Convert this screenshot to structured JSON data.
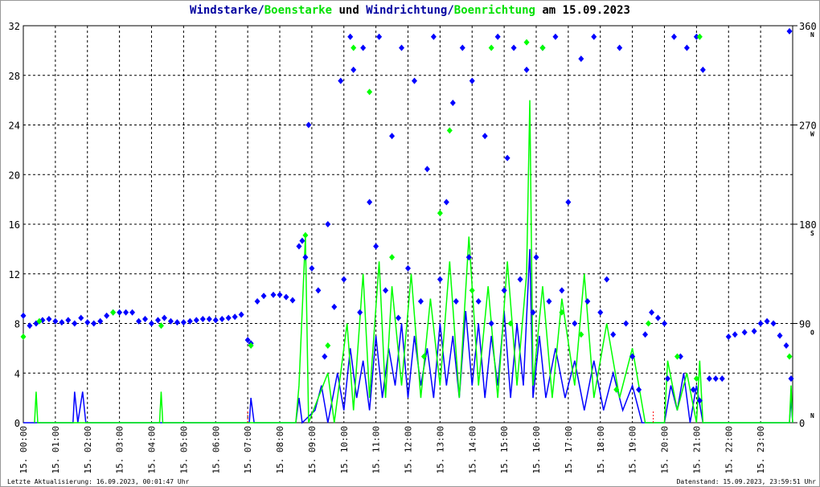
{
  "title": {
    "part1": "Windstarke",
    "sep1": "/",
    "part2": "Boenstarke",
    "mid": " und ",
    "part3": "Windrichtung",
    "sep2": "/",
    "part4": "Boenrichtung",
    "end": " am 15.09.2023"
  },
  "footer": {
    "left": "Letzte Aktualisierung: 16.09.2023, 00:01:47 Uhr",
    "right": "Datenstand: 15.09.2023, 23:59:51 Uhr"
  },
  "chart_data": {
    "type": "line",
    "title": "Windstarke/Boenstarke und Windrichtung/Boenrichtung am 15.09.2023",
    "xlabel": "",
    "ylabel": "",
    "xlim": [
      0,
      24
    ],
    "ylim": [
      0,
      32
    ],
    "y2lim": [
      0,
      360
    ],
    "y_ticks": [
      "0",
      "4",
      "8",
      "12",
      "16",
      "20",
      "24",
      "28",
      "32"
    ],
    "y2_ticks": [
      "0",
      "90",
      "180",
      "270",
      "360"
    ],
    "y2_compass": [
      "N",
      "O",
      "S",
      "W",
      "N"
    ],
    "x_ticks": [
      "15. 00:00",
      "15. 01:00",
      "15. 02:00",
      "15. 03:00",
      "15. 04:00",
      "15. 05:00",
      "15. 06:00",
      "15. 07:00",
      "15. 08:00",
      "15. 09:00",
      "15. 10:00",
      "15. 11:00",
      "15. 12:00",
      "15. 13:00",
      "15. 14:00",
      "15. 15:00",
      "15. 16:00",
      "15. 17:00",
      "15. 18:00",
      "15. 19:00",
      "15. 20:00",
      "15. 21:00",
      "15. 22:00",
      "15. 23:00"
    ],
    "grid": true,
    "colors": {
      "wind": "#0000ff",
      "gust": "#00ff00",
      "calm": "#ff0000"
    },
    "series": [
      {
        "name": "Windstarke",
        "axis": "left",
        "points": [
          [
            0,
            0
          ],
          [
            1.55,
            0
          ],
          [
            1.6,
            2.5
          ],
          [
            1.7,
            0
          ],
          [
            1.85,
            2.5
          ],
          [
            1.95,
            0
          ],
          [
            7.05,
            0
          ],
          [
            7.1,
            2
          ],
          [
            7.2,
            0
          ],
          [
            8.5,
            0
          ],
          [
            8.6,
            2
          ],
          [
            8.7,
            0
          ],
          [
            9.1,
            1
          ],
          [
            9.3,
            3
          ],
          [
            9.5,
            0
          ],
          [
            9.8,
            4
          ],
          [
            10,
            1
          ],
          [
            10.2,
            6
          ],
          [
            10.4,
            2
          ],
          [
            10.6,
            5
          ],
          [
            10.8,
            1
          ],
          [
            11,
            7
          ],
          [
            11.2,
            2
          ],
          [
            11.4,
            6
          ],
          [
            11.6,
            3
          ],
          [
            11.8,
            8
          ],
          [
            12,
            2
          ],
          [
            12.2,
            7
          ],
          [
            12.4,
            3
          ],
          [
            12.6,
            6
          ],
          [
            12.8,
            2
          ],
          [
            13,
            8
          ],
          [
            13.2,
            3
          ],
          [
            13.4,
            7
          ],
          [
            13.6,
            2
          ],
          [
            13.8,
            9
          ],
          [
            14,
            3
          ],
          [
            14.2,
            8
          ],
          [
            14.4,
            2
          ],
          [
            14.6,
            7
          ],
          [
            14.8,
            3
          ],
          [
            15,
            9
          ],
          [
            15.2,
            2
          ],
          [
            15.4,
            8
          ],
          [
            15.6,
            3
          ],
          [
            15.8,
            14
          ],
          [
            15.9,
            2
          ],
          [
            16.1,
            7
          ],
          [
            16.3,
            2
          ],
          [
            16.6,
            6
          ],
          [
            16.9,
            2
          ],
          [
            17.2,
            5
          ],
          [
            17.5,
            1
          ],
          [
            17.8,
            5
          ],
          [
            18.1,
            1
          ],
          [
            18.4,
            4
          ],
          [
            18.7,
            1
          ],
          [
            19,
            3
          ],
          [
            19.3,
            0
          ],
          [
            20,
            0
          ],
          [
            20.2,
            3
          ],
          [
            20.4,
            1
          ],
          [
            20.6,
            4
          ],
          [
            20.8,
            0
          ],
          [
            21,
            3
          ],
          [
            21.2,
            0
          ],
          [
            23.9,
            0
          ],
          [
            23.95,
            2
          ],
          [
            24,
            0
          ]
        ]
      },
      {
        "name": "Boenstarke",
        "axis": "left",
        "points": [
          [
            0.35,
            0
          ],
          [
            0.4,
            2.5
          ],
          [
            0.45,
            0
          ],
          [
            4.25,
            0
          ],
          [
            4.3,
            2.5
          ],
          [
            4.35,
            0
          ],
          [
            8.5,
            0
          ],
          [
            8.6,
            3
          ],
          [
            8.8,
            15
          ],
          [
            8.9,
            0
          ],
          [
            9.5,
            4
          ],
          [
            9.7,
            0
          ],
          [
            10.1,
            8
          ],
          [
            10.3,
            1
          ],
          [
            10.6,
            12
          ],
          [
            10.8,
            2
          ],
          [
            11.1,
            13
          ],
          [
            11.3,
            2
          ],
          [
            11.5,
            11
          ],
          [
            11.8,
            3
          ],
          [
            12.1,
            12
          ],
          [
            12.4,
            2
          ],
          [
            12.7,
            10
          ],
          [
            13,
            3
          ],
          [
            13.3,
            13
          ],
          [
            13.6,
            2
          ],
          [
            13.9,
            15
          ],
          [
            14.2,
            3
          ],
          [
            14.5,
            11
          ],
          [
            14.8,
            2
          ],
          [
            15.1,
            13
          ],
          [
            15.4,
            3
          ],
          [
            15.7,
            12
          ],
          [
            15.8,
            26
          ],
          [
            15.9,
            3
          ],
          [
            16.2,
            11
          ],
          [
            16.5,
            2
          ],
          [
            16.8,
            10
          ],
          [
            17.2,
            3
          ],
          [
            17.5,
            12
          ],
          [
            17.8,
            2
          ],
          [
            18.2,
            8
          ],
          [
            18.6,
            2
          ],
          [
            19,
            6
          ],
          [
            19.4,
            0
          ],
          [
            20,
            0
          ],
          [
            20.1,
            5
          ],
          [
            20.4,
            1
          ],
          [
            20.7,
            4
          ],
          [
            21,
            0
          ],
          [
            21.1,
            5
          ],
          [
            21.2,
            0
          ],
          [
            23.9,
            0
          ],
          [
            23.95,
            3
          ],
          [
            24,
            0
          ]
        ]
      },
      {
        "name": "Windrichtung",
        "axis": "right",
        "kind": "scatter",
        "points": [
          [
            0,
            97
          ],
          [
            0.2,
            88
          ],
          [
            0.4,
            90
          ],
          [
            0.6,
            93
          ],
          [
            0.8,
            94
          ],
          [
            1,
            92
          ],
          [
            1.2,
            91
          ],
          [
            1.4,
            93
          ],
          [
            1.6,
            90
          ],
          [
            1.8,
            95
          ],
          [
            2,
            91
          ],
          [
            2.2,
            90
          ],
          [
            2.4,
            92
          ],
          [
            2.6,
            97
          ],
          [
            2.8,
            100
          ],
          [
            3,
            100
          ],
          [
            3.2,
            100
          ],
          [
            3.4,
            100
          ],
          [
            3.6,
            92
          ],
          [
            3.8,
            94
          ],
          [
            4,
            90
          ],
          [
            4.2,
            93
          ],
          [
            4.4,
            95
          ],
          [
            4.6,
            92
          ],
          [
            4.8,
            91
          ],
          [
            5,
            91
          ],
          [
            5.2,
            92
          ],
          [
            5.4,
            93
          ],
          [
            5.6,
            94
          ],
          [
            5.8,
            94
          ],
          [
            6,
            93
          ],
          [
            6.2,
            94
          ],
          [
            6.4,
            95
          ],
          [
            6.6,
            96
          ],
          [
            6.8,
            98
          ],
          [
            7,
            75
          ],
          [
            7.1,
            72
          ],
          [
            7.3,
            110
          ],
          [
            7.5,
            115
          ],
          [
            7.8,
            116
          ],
          [
            8,
            116
          ],
          [
            8.2,
            114
          ],
          [
            8.4,
            111
          ],
          [
            8.6,
            160
          ],
          [
            8.7,
            165
          ],
          [
            8.8,
            150
          ],
          [
            8.9,
            270
          ],
          [
            9,
            140
          ],
          [
            9.2,
            120
          ],
          [
            9.4,
            60
          ],
          [
            9.5,
            180
          ],
          [
            9.7,
            105
          ],
          [
            9.9,
            310
          ],
          [
            10,
            130
          ],
          [
            10.2,
            350
          ],
          [
            10.3,
            320
          ],
          [
            10.5,
            100
          ],
          [
            10.6,
            340
          ],
          [
            10.8,
            200
          ],
          [
            11,
            160
          ],
          [
            11.1,
            350
          ],
          [
            11.3,
            120
          ],
          [
            11.5,
            260
          ],
          [
            11.7,
            95
          ],
          [
            11.8,
            340
          ],
          [
            12,
            140
          ],
          [
            12.2,
            310
          ],
          [
            12.4,
            110
          ],
          [
            12.6,
            230
          ],
          [
            12.8,
            350
          ],
          [
            13,
            130
          ],
          [
            13.2,
            200
          ],
          [
            13.4,
            290
          ],
          [
            13.5,
            110
          ],
          [
            13.7,
            340
          ],
          [
            13.9,
            150
          ],
          [
            14,
            310
          ],
          [
            14.2,
            110
          ],
          [
            14.4,
            260
          ],
          [
            14.6,
            90
          ],
          [
            14.8,
            350
          ],
          [
            15,
            120
          ],
          [
            15.1,
            240
          ],
          [
            15.3,
            340
          ],
          [
            15.5,
            130
          ],
          [
            15.7,
            320
          ],
          [
            15.9,
            100
          ],
          [
            16,
            150
          ],
          [
            16.2,
            340
          ],
          [
            16.4,
            110
          ],
          [
            16.6,
            350
          ],
          [
            16.8,
            120
          ],
          [
            17,
            200
          ],
          [
            17.2,
            90
          ],
          [
            17.4,
            330
          ],
          [
            17.6,
            110
          ],
          [
            17.8,
            350
          ],
          [
            18,
            100
          ],
          [
            18.2,
            130
          ],
          [
            18.4,
            80
          ],
          [
            18.6,
            340
          ],
          [
            18.8,
            90
          ],
          [
            19,
            60
          ],
          [
            19.2,
            30
          ],
          [
            19.4,
            80
          ],
          [
            19.6,
            100
          ],
          [
            19.8,
            95
          ],
          [
            20,
            90
          ],
          [
            20.1,
            40
          ],
          [
            20.3,
            350
          ],
          [
            20.5,
            60
          ],
          [
            20.7,
            340
          ],
          [
            20.9,
            30
          ],
          [
            21,
            350
          ],
          [
            21.1,
            20
          ],
          [
            21.2,
            320
          ],
          [
            21.4,
            40
          ],
          [
            21.6,
            40
          ],
          [
            21.8,
            40
          ],
          [
            22,
            78
          ],
          [
            22.2,
            80
          ],
          [
            22.5,
            82
          ],
          [
            22.8,
            83
          ],
          [
            23,
            90
          ],
          [
            23.2,
            92
          ],
          [
            23.4,
            90
          ],
          [
            23.6,
            79
          ],
          [
            23.8,
            70
          ],
          [
            23.9,
            355
          ],
          [
            23.95,
            40
          ]
        ]
      },
      {
        "name": "Boenrichtung",
        "axis": "right",
        "kind": "scatter",
        "points": [
          [
            0,
            78
          ],
          [
            0.5,
            92
          ],
          [
            2.8,
            100
          ],
          [
            4.3,
            88
          ],
          [
            7.1,
            70
          ],
          [
            8.8,
            170
          ],
          [
            9.5,
            70
          ],
          [
            10.3,
            340
          ],
          [
            10.8,
            300
          ],
          [
            11.5,
            150
          ],
          [
            12.5,
            60
          ],
          [
            13,
            190
          ],
          [
            13.3,
            265
          ],
          [
            14,
            120
          ],
          [
            14.6,
            340
          ],
          [
            15.2,
            90
          ],
          [
            15.7,
            345
          ],
          [
            16.2,
            340
          ],
          [
            16.8,
            100
          ],
          [
            17.4,
            80
          ],
          [
            18.5,
            30
          ],
          [
            19.5,
            90
          ],
          [
            20.4,
            60
          ],
          [
            21,
            40
          ],
          [
            21.1,
            350
          ],
          [
            23.9,
            60
          ]
        ]
      }
    ]
  }
}
